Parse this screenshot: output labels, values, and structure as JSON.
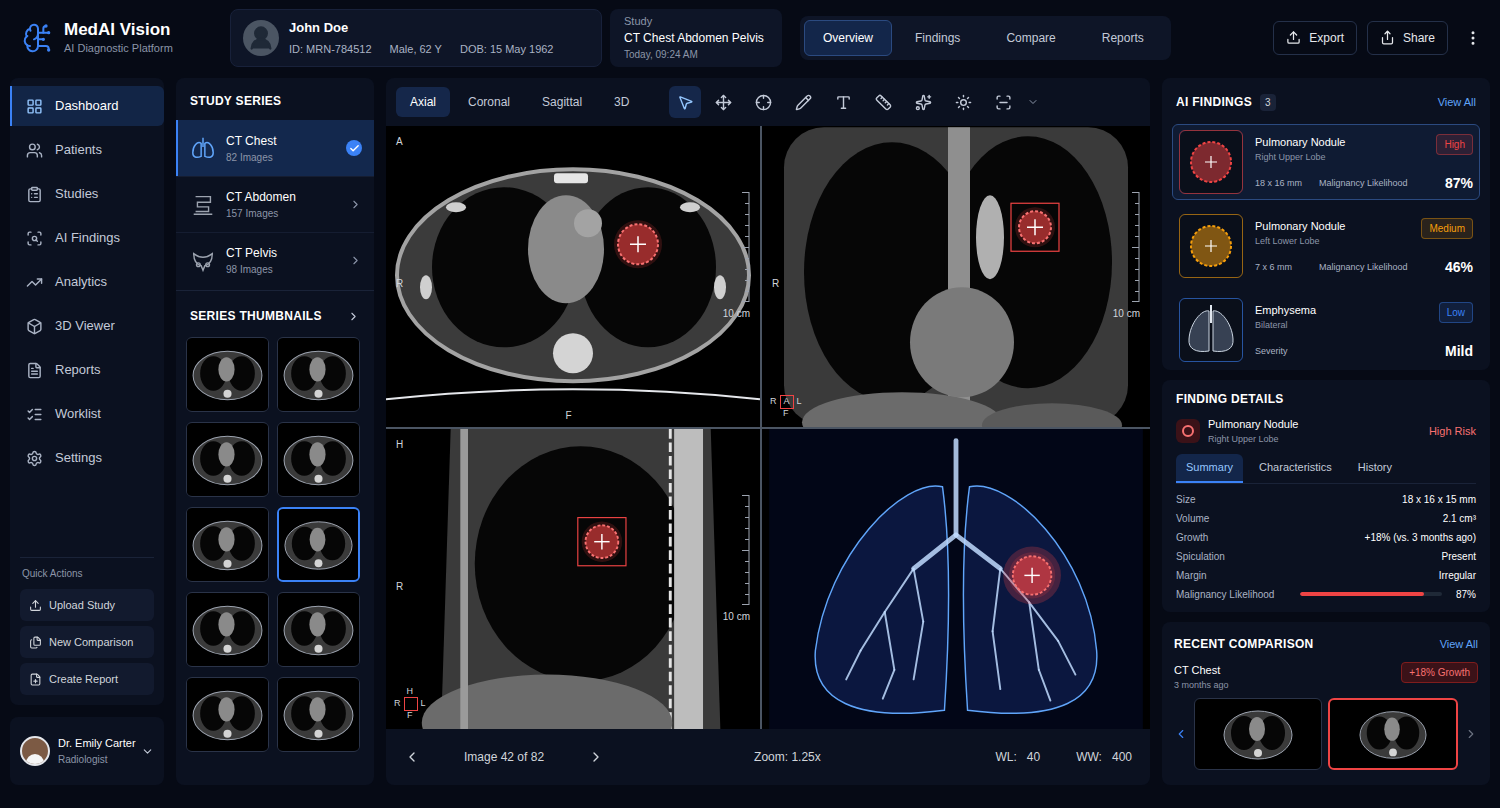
{
  "app": {
    "name": "MedAI Vision",
    "subtitle": "AI Diagnostic Platform"
  },
  "patient": {
    "name": "John Doe",
    "id": "ID: MRN-784512",
    "sex_age": "Male, 62 Y",
    "dob": "DOB: 15 May 1962"
  },
  "study": {
    "label": "Study",
    "title": "CT Chest Abdomen Pelvis",
    "time": "Today, 09:24 AM"
  },
  "top_tabs": [
    {
      "label": "Overview",
      "selected": true
    },
    {
      "label": "Findings",
      "selected": false
    },
    {
      "label": "Compare",
      "selected": false
    },
    {
      "label": "Reports",
      "selected": false
    }
  ],
  "top_actions": [
    {
      "label": "Export"
    },
    {
      "label": "Share"
    }
  ],
  "sidebar": {
    "items": [
      {
        "label": "Dashboard",
        "selected": true
      },
      {
        "label": "Patients",
        "selected": false
      },
      {
        "label": "Studies",
        "selected": false
      },
      {
        "label": "AI Findings",
        "selected": false
      },
      {
        "label": "Analytics",
        "selected": false
      },
      {
        "label": "3D Viewer",
        "selected": false
      },
      {
        "label": "Reports",
        "selected": false
      },
      {
        "label": "Worklist",
        "selected": false
      },
      {
        "label": "Settings",
        "selected": false
      }
    ],
    "quick_actions_title": "Quick Actions",
    "quick_actions": [
      {
        "label": "Upload Study"
      },
      {
        "label": "New Comparison"
      },
      {
        "label": "Create Report"
      }
    ],
    "user": {
      "name": "Dr. Emily Carter",
      "role": "Radiologist"
    }
  },
  "study_series": {
    "title": "STUDY SERIES",
    "items": [
      {
        "name": "CT Chest",
        "count": "82 Images",
        "selected": true
      },
      {
        "name": "CT Abdomen",
        "count": "157 Images",
        "selected": false
      },
      {
        "name": "CT Pelvis",
        "count": "98 Images",
        "selected": false
      }
    ],
    "thumbnails_title": "SERIES THUMBNAILS",
    "thumbnails": [
      {
        "selected": false
      },
      {
        "selected": false
      },
      {
        "selected": false
      },
      {
        "selected": false
      },
      {
        "selected": false
      },
      {
        "selected": true
      },
      {
        "selected": false
      },
      {
        "selected": false
      },
      {
        "selected": false
      },
      {
        "selected": false
      }
    ]
  },
  "viewer": {
    "views": [
      {
        "label": "Axial",
        "selected": true
      },
      {
        "label": "Coronal",
        "selected": false
      },
      {
        "label": "Sagittal",
        "selected": false
      },
      {
        "label": "3D",
        "selected": false
      }
    ],
    "tools": [
      {
        "selected": true
      },
      {
        "selected": false
      },
      {
        "selected": false
      },
      {
        "selected": false
      },
      {
        "selected": false
      },
      {
        "selected": false
      },
      {
        "selected": false
      },
      {
        "selected": false
      },
      {
        "selected": false
      },
      {
        "selected": false
      }
    ],
    "viewports": [
      {
        "kind": "axial",
        "corner": "A",
        "side": "R",
        "bottom": "F",
        "scale": "10 cm"
      },
      {
        "kind": "coronal",
        "side": "R",
        "scale": "10 cm",
        "orientation": {
          "left": "R",
          "center": "A",
          "right": "L",
          "bottom": "F"
        }
      },
      {
        "kind": "sagittal",
        "corner": "H",
        "side": "R",
        "scale": "10 cm",
        "orientation": {
          "top": "H",
          "left": "R",
          "right": "L",
          "bottom": "F"
        }
      },
      {
        "kind": "render3d"
      }
    ],
    "footer": {
      "image": "Image 42 of 82",
      "zoom": "Zoom: 1.25x",
      "wl_label": "WL:",
      "wl": "40",
      "ww_label": "WW:",
      "ww": "400"
    }
  },
  "ai_findings": {
    "title": "AI FINDINGS",
    "count": "3",
    "view_all": "View All",
    "items": [
      {
        "name": "Pulmonary Nodule",
        "location": "Right Upper Lobe",
        "badge": "High",
        "color": "#ef4444",
        "size": "18 x 16 mm",
        "metric_label": "Malignancy Likelihood",
        "metric": "87%",
        "selected": true,
        "kind": "nodule"
      },
      {
        "name": "Pulmonary Nodule",
        "location": "Left Lower Lobe",
        "badge": "Medium",
        "color": "#f59e0b",
        "size": "7 x 6 mm",
        "metric_label": "Malignancy Likelihood",
        "metric": "46%",
        "selected": false,
        "kind": "nodule"
      },
      {
        "name": "Emphysema",
        "location": "Bilateral",
        "badge": "Low",
        "color": "#3b82f6",
        "metric_label": "Severity",
        "metric": "Mild",
        "selected": false,
        "kind": "lungs"
      }
    ]
  },
  "finding_details": {
    "title": "FINDING DETAILS",
    "name": "Pulmonary Nodule",
    "location": "Right Upper Lobe",
    "risk": "High Risk",
    "tabs": [
      {
        "label": "Summary",
        "selected": true
      },
      {
        "label": "Characteristics",
        "selected": false
      },
      {
        "label": "History",
        "selected": false
      }
    ],
    "rows": [
      {
        "label": "Size",
        "value": "18 x 16 x 15 mm"
      },
      {
        "label": "Volume",
        "value": "2.1 cm³"
      },
      {
        "label": "Growth",
        "value": "+18% (vs. 3 months ago)"
      },
      {
        "label": "Spiculation",
        "value": "Present"
      },
      {
        "label": "Margin",
        "value": "Irregular"
      }
    ],
    "likelihood": {
      "label": "Malignancy Likelihood",
      "value": "87%",
      "level": 0.87
    }
  },
  "recent_comparison": {
    "title": "RECENT COMPARISON",
    "view_all": "View All",
    "study": "CT Chest",
    "time": "3 months ago",
    "badge": "+18% Growth",
    "images": [
      {
        "selected": false
      },
      {
        "selected": true
      }
    ]
  }
}
